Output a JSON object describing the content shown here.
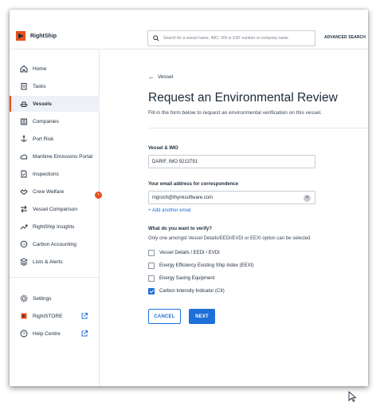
{
  "brand": {
    "name": "RightShip"
  },
  "search": {
    "placeholder": "Search for a vessel name, IMO, VIN or ENT number or company name",
    "advanced_label": "ADVANCED SEARCH"
  },
  "sidebar": {
    "items": [
      {
        "label": "Home",
        "icon": "home-icon"
      },
      {
        "label": "Tasks",
        "icon": "clipboard-icon"
      },
      {
        "label": "Vessels",
        "icon": "ship-icon",
        "active": true
      },
      {
        "label": "Companies",
        "icon": "building-icon"
      },
      {
        "label": "Port Risk",
        "icon": "anchor-icon"
      },
      {
        "label": "Maritime Emissions Portal",
        "icon": "cloud-icon"
      },
      {
        "label": "Inspections",
        "icon": "document-icon"
      },
      {
        "label": "Crew Welfare",
        "icon": "handshake-icon"
      },
      {
        "label": "Vessel Comparison",
        "icon": "compare-icon"
      },
      {
        "label": "RightShip Insights",
        "icon": "trend-icon"
      },
      {
        "label": "Carbon Accounting",
        "icon": "carbon-icon"
      },
      {
        "label": "Lists & Alerts",
        "icon": "layers-icon"
      }
    ],
    "bottom": [
      {
        "label": "Settings",
        "icon": "gear-icon"
      },
      {
        "label": "RightSTORE",
        "icon": "store-icon"
      },
      {
        "label": "Help Centre",
        "icon": "help-icon"
      }
    ],
    "accent_color": "#e8501d"
  },
  "main": {
    "back_label": "Vessel",
    "title": "Request an Environmental Review",
    "subtitle": "Fill in the form below to request an environmental verification on this vessel.",
    "vessel_label": "Vessel & IMO",
    "vessel_value": "DARIF, IMO 9213791",
    "email_label": "Your email address for correspondence",
    "email_value": "mgroch@thynksoftware.com",
    "add_email": "+ Add another email",
    "verify_label": "What do you want to verify?",
    "verify_hint": "Only one amongst Vessel Details/EEDI/EVDI or EEXI option can be selected",
    "options": [
      {
        "label": "Vessel Details / EEDI / EVDI",
        "checked": false
      },
      {
        "label": "Energy Efficiency Existing Ship Index (EEXI)",
        "checked": false
      },
      {
        "label": "Energy Saving Equipment",
        "checked": false
      },
      {
        "label": "Carbon Intensity Indicator (CII)",
        "checked": true
      }
    ],
    "cancel_label": "CANCEL",
    "next_label": "NEXT",
    "primary_color": "#1e6fd9"
  }
}
